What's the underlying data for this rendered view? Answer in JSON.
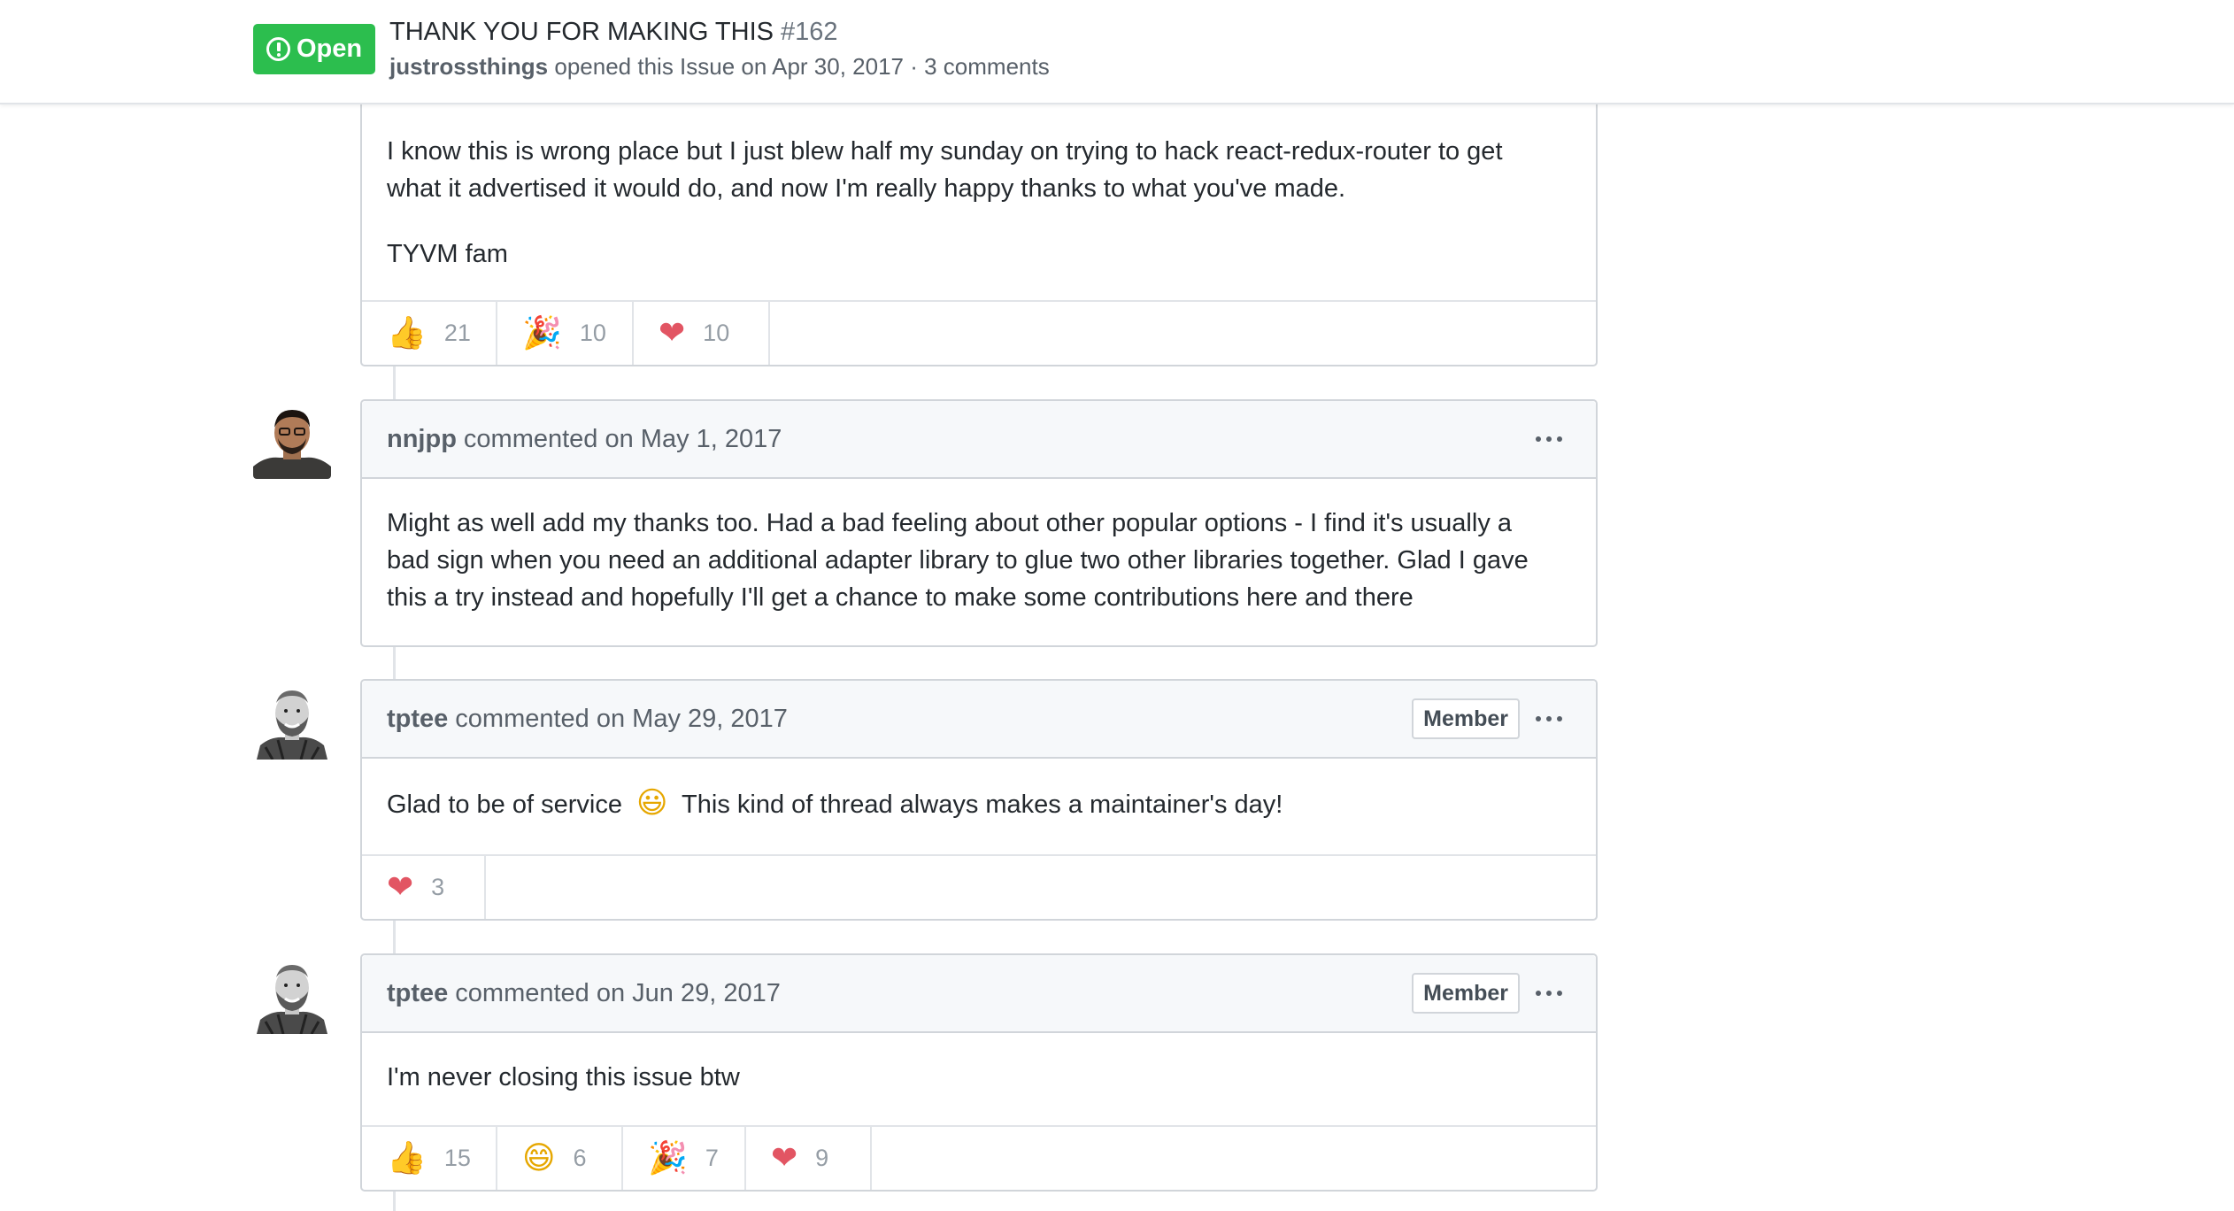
{
  "issue": {
    "state": "Open",
    "title": "THANK YOU FOR MAKING THIS",
    "number": "#162",
    "author": "justrossthings",
    "meta": "opened this Issue on Apr 30, 2017 · 3 comments"
  },
  "first_comment": {
    "paragraphs": [
      "I know this is wrong place but I just blew half my sunday on trying to hack react-redux-router to get",
      "what it advertised it would do, and now I'm really happy thanks to what you've made.",
      "TYVM fam"
    ],
    "reactions": [
      {
        "icon": "thumbs-up-icon",
        "emoji": "👍",
        "count": "21"
      },
      {
        "icon": "tada-icon",
        "emoji": "🎉",
        "count": "10"
      },
      {
        "icon": "heart-icon",
        "emoji": "❤",
        "count": "10"
      }
    ]
  },
  "comments": [
    {
      "author": "nnjpp",
      "meta": "commented on May 1, 2017",
      "lines": [
        "Might as well add my thanks too. Had a bad feeling about other popular options - I find it's usually a",
        "bad sign when you need an additional adapter library to glue two other libraries together. Glad I gave",
        "this a try instead and hopefully I'll get a chance to make some contributions here and there"
      ]
    },
    {
      "author": "tptee",
      "meta": "commented on May 29, 2017",
      "badge": "Member",
      "text_before": "Glad to be of service",
      "emoji": "😃",
      "text_after": "This kind of thread always makes a maintainer's day!",
      "reactions": [
        {
          "icon": "heart-icon",
          "emoji": "❤",
          "count": "3"
        }
      ]
    },
    {
      "author": "tptee",
      "meta": "commented on Jun 29, 2017",
      "badge": "Member",
      "text": "I'm never closing this issue btw",
      "reactions": [
        {
          "icon": "thumbs-up-icon",
          "emoji": "👍",
          "count": "15"
        },
        {
          "icon": "smile-icon",
          "emoji": "😄",
          "count": "6"
        },
        {
          "icon": "tada-icon",
          "emoji": "🎉",
          "count": "7"
        },
        {
          "icon": "heart-icon",
          "emoji": "❤",
          "count": "9"
        }
      ]
    }
  ],
  "colors": {
    "open_green": "#2cbe4e",
    "heart_red": "#e25563",
    "border": "#d1d5da",
    "header_bg": "#f6f8fa"
  }
}
